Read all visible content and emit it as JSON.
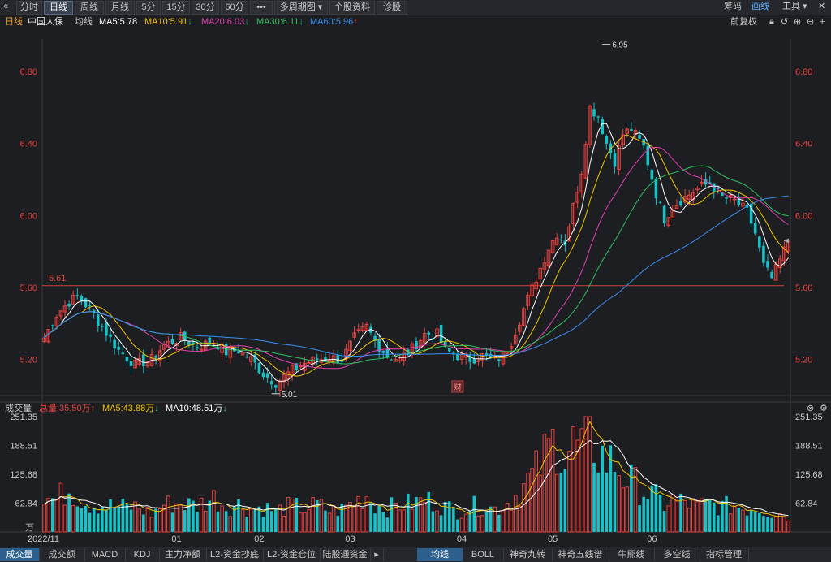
{
  "toolbar": {
    "back_icon": "«",
    "tabs": [
      "分时",
      "日线",
      "周线",
      "月线",
      "5分",
      "15分",
      "30分",
      "60分",
      "•••",
      "多周期图 ▾",
      "个股资料",
      "诊股"
    ],
    "active_tab": 1,
    "right": [
      "筹码",
      "画线",
      "工具 ▾"
    ]
  },
  "header": {
    "period": "日线",
    "name": "中国人保",
    "avg_label": "均线",
    "ma5": "MA5:5.78",
    "ma10": "MA10:5.91",
    "ma20": "MA20:6.03",
    "ma30": "MA30:6.11",
    "ma60": "MA60:5.96",
    "adj": "前复权"
  },
  "volume_header": {
    "label": "成交量",
    "total": "总量:35.50万",
    "ma5": "MA5:43.88万",
    "ma10": "MA10:48.51万"
  },
  "bottom_tabs": [
    "成交量",
    "成交额",
    "MACD",
    "KDJ",
    "主力净额",
    "L2-资金抄底",
    "L2-资金仓位",
    "陆股通资金"
  ],
  "bottom_tabs2": [
    "均线",
    "BOLL",
    "神奇九转",
    "神奇五线谱",
    "牛熊线",
    "多空线",
    "指标管理"
  ],
  "colors": {
    "up": "#e8413e",
    "down": "#17c3c9",
    "ma5": "#ffffff",
    "ma10": "#f2c200",
    "ma20": "#e040b0",
    "ma30": "#30c060",
    "ma60": "#3a8ff0"
  },
  "chart_data": {
    "type": "candlestick",
    "price_axis": {
      "ylim": [
        5.0,
        6.98
      ],
      "ticks": [
        5.2,
        5.6,
        6.0,
        6.4,
        6.8
      ],
      "tick_labels": [
        "5.20",
        "5.60",
        "6.00",
        "6.40",
        "6.80"
      ]
    },
    "reference_line": {
      "value": 5.61,
      "label": "5.61"
    },
    "annotations": [
      {
        "label": "6.95",
        "value": 6.95,
        "index": 135
      },
      {
        "label": "5.01",
        "value": 5.01,
        "index": 55
      },
      {
        "label": "财",
        "index": 100
      }
    ],
    "x_labels": [
      {
        "label": "2022/11",
        "index": 0
      },
      {
        "label": "01",
        "index": 32
      },
      {
        "label": "02",
        "index": 52
      },
      {
        "label": "03",
        "index": 74
      },
      {
        "label": "04",
        "index": 101
      },
      {
        "label": "05",
        "index": 123
      },
      {
        "label": "06",
        "index": 147
      }
    ],
    "volume_axis": {
      "ylim": [
        0,
        251.35
      ],
      "ticks": [
        62.84,
        125.68,
        188.51,
        251.35
      ],
      "tick_labels": [
        "62.84",
        "125.68",
        "188.51",
        "251.35"
      ],
      "unit": "万"
    },
    "anchors": [
      [
        0,
        5.32
      ],
      [
        3,
        5.45
      ],
      [
        6,
        5.52
      ],
      [
        8,
        5.55
      ],
      [
        11,
        5.48
      ],
      [
        14,
        5.38
      ],
      [
        18,
        5.25
      ],
      [
        22,
        5.17
      ],
      [
        26,
        5.2
      ],
      [
        29,
        5.28
      ],
      [
        33,
        5.32
      ],
      [
        37,
        5.27
      ],
      [
        41,
        5.3
      ],
      [
        44,
        5.24
      ],
      [
        47,
        5.25
      ],
      [
        50,
        5.2
      ],
      [
        53,
        5.12
      ],
      [
        56,
        5.07
      ],
      [
        60,
        5.14
      ],
      [
        63,
        5.18
      ],
      [
        66,
        5.2
      ],
      [
        69,
        5.21
      ],
      [
        72,
        5.2
      ],
      [
        75,
        5.32
      ],
      [
        78,
        5.38
      ],
      [
        80,
        5.3
      ],
      [
        83,
        5.22
      ],
      [
        86,
        5.2
      ],
      [
        89,
        5.26
      ],
      [
        92,
        5.34
      ],
      [
        95,
        5.34
      ],
      [
        97,
        5.25
      ],
      [
        100,
        5.22
      ],
      [
        103,
        5.2
      ],
      [
        106,
        5.22
      ],
      [
        109,
        5.2
      ],
      [
        111,
        5.22
      ],
      [
        113,
        5.3
      ],
      [
        116,
        5.48
      ],
      [
        119,
        5.65
      ],
      [
        122,
        5.82
      ],
      [
        124,
        5.9
      ],
      [
        126,
        5.85
      ],
      [
        128,
        6.05
      ],
      [
        130,
        6.25
      ],
      [
        132,
        6.6
      ],
      [
        134,
        6.55
      ],
      [
        136,
        6.4
      ],
      [
        138,
        6.3
      ],
      [
        140,
        6.45
      ],
      [
        142,
        6.48
      ],
      [
        145,
        6.38
      ],
      [
        148,
        6.12
      ],
      [
        150,
        5.98
      ],
      [
        152,
        6.05
      ],
      [
        155,
        6.1
      ],
      [
        158,
        6.15
      ],
      [
        161,
        6.18
      ],
      [
        164,
        6.1
      ],
      [
        167,
        6.08
      ],
      [
        170,
        6.02
      ],
      [
        172,
        5.9
      ],
      [
        174,
        5.72
      ],
      [
        176,
        5.65
      ],
      [
        178,
        5.75
      ],
      [
        180,
        5.86
      ]
    ],
    "volume_anchors": [
      [
        0,
        75
      ],
      [
        3,
        70
      ],
      [
        6,
        95
      ],
      [
        8,
        78
      ],
      [
        11,
        60
      ],
      [
        14,
        58
      ],
      [
        18,
        55
      ],
      [
        22,
        55
      ],
      [
        26,
        40
      ],
      [
        29,
        60
      ],
      [
        33,
        62
      ],
      [
        37,
        58
      ],
      [
        41,
        75
      ],
      [
        44,
        55
      ],
      [
        47,
        60
      ],
      [
        50,
        50
      ],
      [
        53,
        55
      ],
      [
        56,
        45
      ],
      [
        60,
        58
      ],
      [
        63,
        50
      ],
      [
        66,
        60
      ],
      [
        69,
        45
      ],
      [
        72,
        50
      ],
      [
        75,
        65
      ],
      [
        78,
        80
      ],
      [
        80,
        60
      ],
      [
        83,
        52
      ],
      [
        86,
        60
      ],
      [
        89,
        62
      ],
      [
        92,
        70
      ],
      [
        95,
        65
      ],
      [
        97,
        55
      ],
      [
        100,
        45
      ],
      [
        103,
        55
      ],
      [
        106,
        58
      ],
      [
        109,
        50
      ],
      [
        111,
        58
      ],
      [
        113,
        70
      ],
      [
        116,
        100
      ],
      [
        119,
        130
      ],
      [
        122,
        180
      ],
      [
        124,
        205
      ],
      [
        126,
        160
      ],
      [
        128,
        190
      ],
      [
        130,
        185
      ],
      [
        132,
        210
      ],
      [
        134,
        175
      ],
      [
        136,
        155
      ],
      [
        138,
        150
      ],
      [
        140,
        120
      ],
      [
        142,
        110
      ],
      [
        145,
        90
      ],
      [
        148,
        75
      ],
      [
        150,
        60
      ],
      [
        152,
        70
      ],
      [
        155,
        65
      ],
      [
        158,
        55
      ],
      [
        161,
        62
      ],
      [
        164,
        55
      ],
      [
        167,
        58
      ],
      [
        170,
        50
      ],
      [
        172,
        55
      ],
      [
        174,
        48
      ],
      [
        176,
        42
      ],
      [
        178,
        40
      ],
      [
        180,
        35
      ]
    ],
    "count": 181
  }
}
